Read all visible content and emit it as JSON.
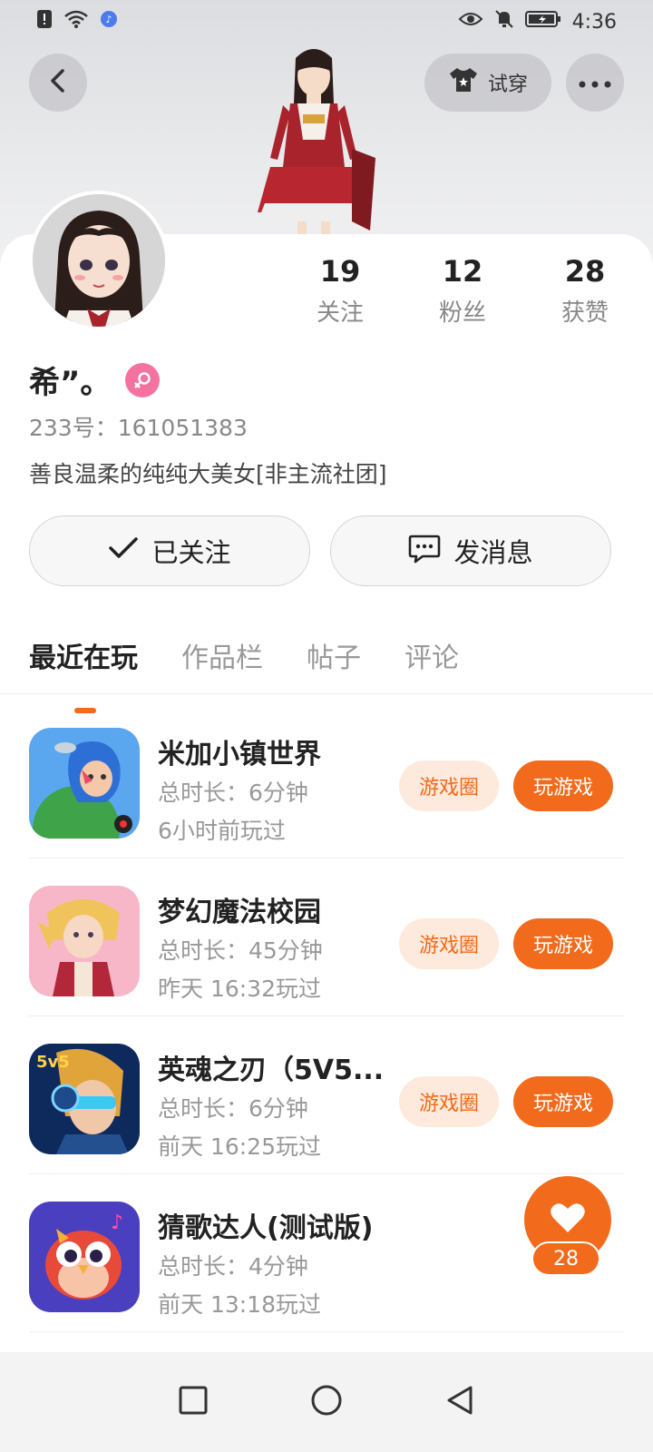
{
  "status_bar": {
    "time": "4:36"
  },
  "header": {
    "tryon_label": "试穿"
  },
  "profile": {
    "name": "希”。",
    "uid": "233号：161051383",
    "bio": "善良温柔的纯纯大美女[非主流社团]",
    "stats": [
      {
        "value": "19",
        "label": "关注"
      },
      {
        "value": "12",
        "label": "粉丝"
      },
      {
        "value": "28",
        "label": "获赞"
      }
    ]
  },
  "actions": {
    "follow_label": "已关注",
    "message_label": "发消息"
  },
  "tabs": [
    {
      "label": "最近在玩",
      "active": true
    },
    {
      "label": "作品栏",
      "active": false
    },
    {
      "label": "帖子",
      "active": false
    },
    {
      "label": "评论",
      "active": false
    }
  ],
  "games": [
    {
      "title": "米加小镇世界",
      "duration": "总时长：6分钟",
      "last_played": "6小时前玩过",
      "circle_label": "游戏圈",
      "play_label": "玩游戏"
    },
    {
      "title": "梦幻魔法校园",
      "duration": "总时长：45分钟",
      "last_played": "昨天 16:32玩过",
      "circle_label": "游戏圈",
      "play_label": "玩游戏"
    },
    {
      "title": "英魂之刃（5V5...",
      "duration": "总时长：6分钟",
      "last_played": "前天 16:25玩过",
      "circle_label": "游戏圈",
      "play_label": "玩游戏"
    },
    {
      "title": "猜歌达人(测试版)",
      "duration": "总时长：4分钟",
      "last_played": "前天 13:18玩过"
    }
  ],
  "like_float": {
    "count": "28"
  },
  "colors": {
    "accent": "#f26a1b",
    "accent_light": "#fdeadc",
    "gender_female": "#f472a0"
  }
}
